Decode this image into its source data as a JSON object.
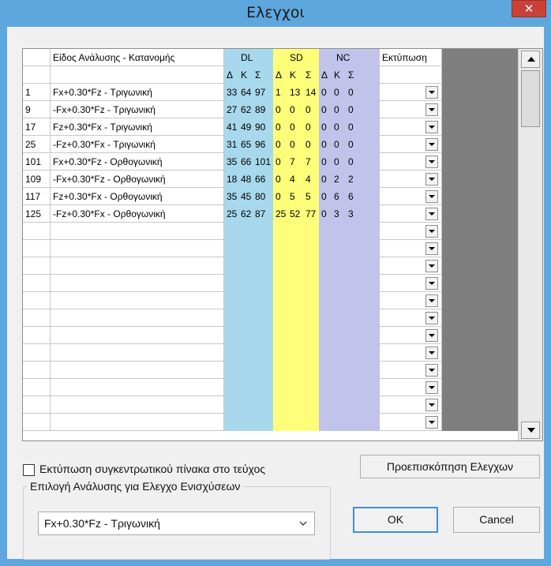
{
  "window": {
    "title": "Ελεγχοι",
    "close_glyph": "✕"
  },
  "grid": {
    "header1": {
      "analysis_type": "Είδος Ανάλυσης - Κατανομής",
      "group_dl": "DL",
      "group_sd": "SD",
      "group_nc": "NC",
      "print": "Εκτύπωση"
    },
    "subheaders": [
      "Δ",
      "Κ",
      "Σ",
      "Δ",
      "Κ",
      "Σ",
      "Δ",
      "Κ",
      "Σ"
    ],
    "rows": [
      {
        "id": "1",
        "name": "Fx+0.30*Fz - Τριγωνική",
        "v": [
          "33",
          "64",
          "97",
          "1",
          "13",
          "14",
          "0",
          "0",
          "0"
        ]
      },
      {
        "id": "9",
        "name": "-Fx+0.30*Fz - Τριγωνική",
        "v": [
          "27",
          "62",
          "89",
          "0",
          "0",
          "0",
          "0",
          "0",
          "0"
        ]
      },
      {
        "id": "17",
        "name": "Fz+0.30*Fx - Τριγωνική",
        "v": [
          "41",
          "49",
          "90",
          "0",
          "0",
          "0",
          "0",
          "0",
          "0"
        ]
      },
      {
        "id": "25",
        "name": "-Fz+0.30*Fx - Τριγωνική",
        "v": [
          "31",
          "65",
          "96",
          "0",
          "0",
          "0",
          "0",
          "0",
          "0"
        ]
      },
      {
        "id": "101",
        "name": "Fx+0.30*Fz - Ορθογωνική",
        "v": [
          "35",
          "66",
          "101",
          "0",
          "7",
          "7",
          "0",
          "0",
          "0"
        ]
      },
      {
        "id": "109",
        "name": "-Fx+0.30*Fz - Ορθογωνική",
        "v": [
          "18",
          "48",
          "66",
          "0",
          "4",
          "4",
          "0",
          "2",
          "2"
        ]
      },
      {
        "id": "117",
        "name": "Fz+0.30*Fx - Ορθογωνική",
        "v": [
          "35",
          "45",
          "80",
          "0",
          "5",
          "5",
          "0",
          "6",
          "6"
        ]
      },
      {
        "id": "125",
        "name": "-Fz+0.30*Fx - Ορθογωνική",
        "v": [
          "25",
          "62",
          "87",
          "25",
          "52",
          "77",
          "0",
          "3",
          "3"
        ]
      }
    ]
  },
  "footer": {
    "summary_checkbox_label": "Εκτύπωση συγκεντρωτικού πίνακα στο τεύχος",
    "preview_button": "Προεπισκόπηση Ελεγχων",
    "analysis_group_label": "Επιλογή Ανάλυσης για Ελεγχο Ενισχύσεων",
    "analysis_selected": "Fx+0.30*Fz - Τριγωνική",
    "ok_button": "OK",
    "cancel_button": "Cancel"
  },
  "colors": {
    "dl_column": "#a8d8ec",
    "sd_column": "#fffe7a",
    "nc_column": "#c2c3ea",
    "title_bar": "#5ea7de",
    "close_button": "#c9423a"
  },
  "icons": [
    "close-icon",
    "dropdown-arrow-icon",
    "scroll-up-icon",
    "scroll-down-icon",
    "combo-chevron-icon"
  ]
}
